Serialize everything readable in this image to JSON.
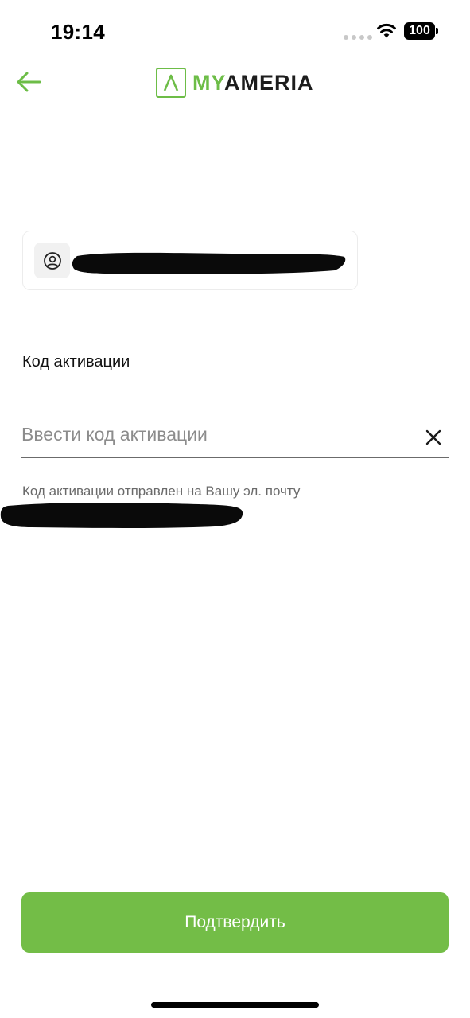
{
  "status_bar": {
    "time": "19:14",
    "battery": "100"
  },
  "header": {
    "logo_my": "MY",
    "logo_ameria": "AMERIA"
  },
  "activation": {
    "label": "Код активации",
    "code_placeholder": "Ввести код активации",
    "code_value": "",
    "hint": "Код активации отправлен на Вашу эл. почту"
  },
  "confirm_label": "Подтвердить",
  "colors": {
    "accent": "#73bd47",
    "logo_green": "#6dbd47",
    "text_dark": "#111111",
    "text_muted": "#6a6a6a"
  },
  "icons": {
    "back": "arrow-left-icon",
    "user": "user-circle-icon",
    "clear": "close-icon",
    "wifi": "wifi-icon",
    "battery": "battery-icon"
  }
}
